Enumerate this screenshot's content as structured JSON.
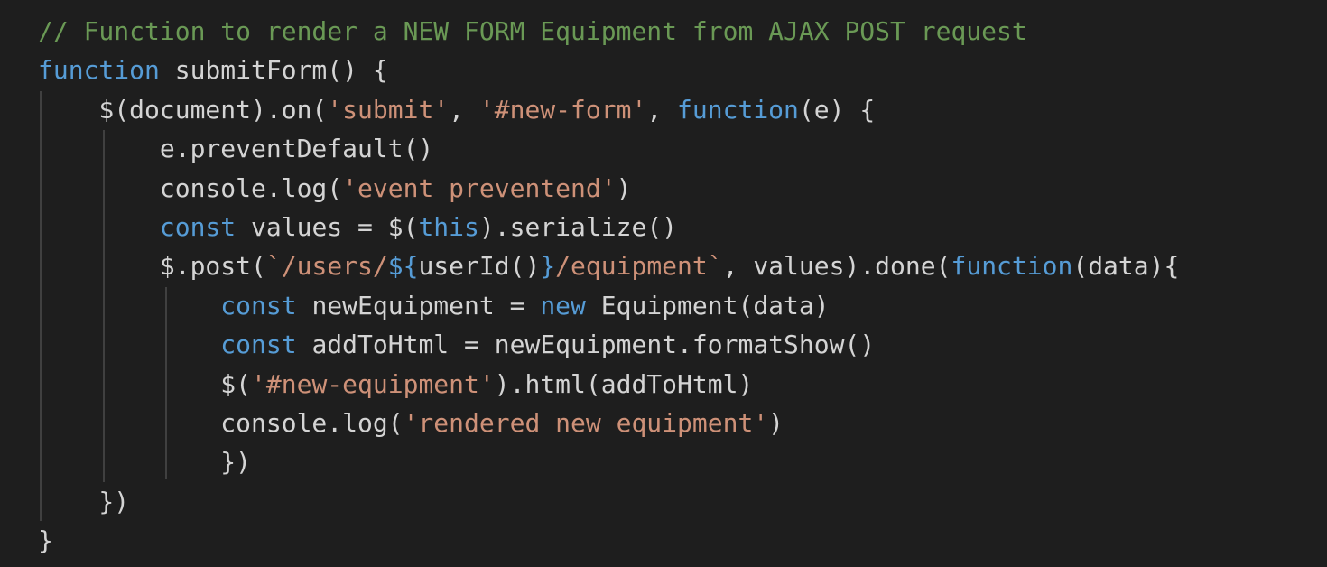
{
  "theme": {
    "background": "#1e1e1e",
    "default_text": "#d4d4d4",
    "comment": "#6a9955",
    "keyword": "#569cd6",
    "string": "#ce9178",
    "indent_guide": "#404040"
  },
  "code_lines": [
    [
      {
        "t": "// Function to render a NEW FORM Equipment from AJAX POST request",
        "k": "comment"
      }
    ],
    [
      {
        "t": "function",
        "k": "keyword"
      },
      {
        "t": " submitForm() {",
        "k": "text"
      }
    ],
    [
      {
        "t": "    $(document).on(",
        "k": "text"
      },
      {
        "t": "'submit'",
        "k": "string"
      },
      {
        "t": ", ",
        "k": "text"
      },
      {
        "t": "'#new-form'",
        "k": "string"
      },
      {
        "t": ", ",
        "k": "text"
      },
      {
        "t": "function",
        "k": "keyword"
      },
      {
        "t": "(e) {",
        "k": "text"
      }
    ],
    [
      {
        "t": "        e.preventDefault()",
        "k": "text"
      }
    ],
    [
      {
        "t": "        console.log(",
        "k": "text"
      },
      {
        "t": "'event preventend'",
        "k": "string"
      },
      {
        "t": ")",
        "k": "text"
      }
    ],
    [
      {
        "t": "        ",
        "k": "text"
      },
      {
        "t": "const",
        "k": "keyword"
      },
      {
        "t": " values = $(",
        "k": "text"
      },
      {
        "t": "this",
        "k": "keyword"
      },
      {
        "t": ").serialize()",
        "k": "text"
      }
    ],
    [
      {
        "t": "        $.post(",
        "k": "text"
      },
      {
        "t": "`/users/",
        "k": "string"
      },
      {
        "t": "${",
        "k": "keyword"
      },
      {
        "t": "userId()",
        "k": "text"
      },
      {
        "t": "}",
        "k": "keyword"
      },
      {
        "t": "/equipment`",
        "k": "string"
      },
      {
        "t": ", values).done(",
        "k": "text"
      },
      {
        "t": "function",
        "k": "keyword"
      },
      {
        "t": "(data){",
        "k": "text"
      }
    ],
    [
      {
        "t": "            ",
        "k": "text"
      },
      {
        "t": "const",
        "k": "keyword"
      },
      {
        "t": " newEquipment = ",
        "k": "text"
      },
      {
        "t": "new",
        "k": "keyword"
      },
      {
        "t": " Equipment(data)",
        "k": "text"
      }
    ],
    [
      {
        "t": "            ",
        "k": "text"
      },
      {
        "t": "const",
        "k": "keyword"
      },
      {
        "t": " addToHtml = newEquipment.formatShow()",
        "k": "text"
      }
    ],
    [
      {
        "t": "            $(",
        "k": "text"
      },
      {
        "t": "'#new-equipment'",
        "k": "string"
      },
      {
        "t": ").html(addToHtml)",
        "k": "text"
      }
    ],
    [
      {
        "t": "            console.log(",
        "k": "text"
      },
      {
        "t": "'rendered new equipment'",
        "k": "string"
      },
      {
        "t": ")",
        "k": "text"
      }
    ],
    [
      {
        "t": "            })",
        "k": "text"
      }
    ],
    [
      {
        "t": "    })",
        "k": "text"
      }
    ],
    [
      {
        "t": "}",
        "k": "text"
      }
    ]
  ]
}
